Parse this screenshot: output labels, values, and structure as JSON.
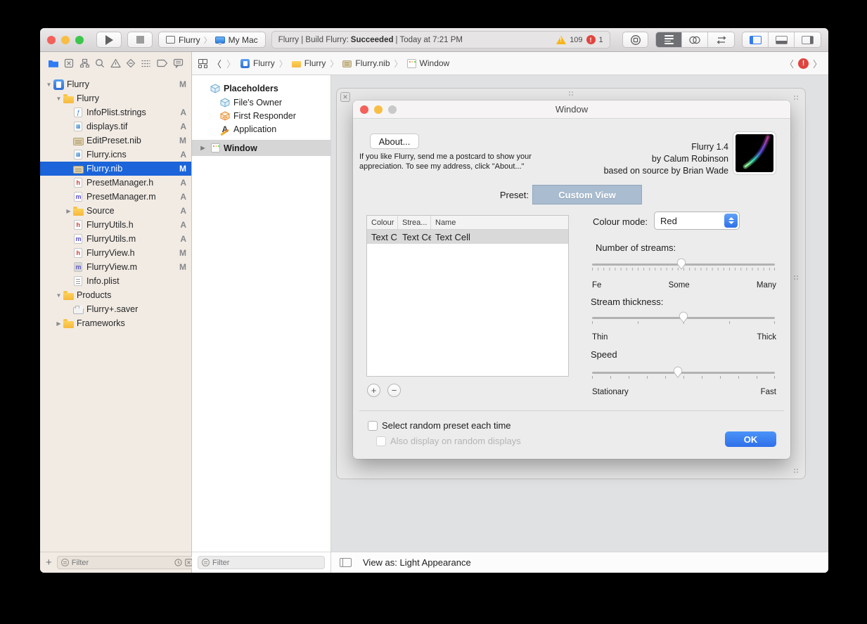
{
  "toolbar": {
    "scheme_project": "Flurry",
    "scheme_target": "My Mac",
    "activity_prefix": "Flurry | Build Flurry:",
    "activity_status": "Succeeded",
    "activity_suffix": "| Today at 7:21 PM",
    "warning_count": "109",
    "error_count": "1"
  },
  "navigator": {
    "filter_placeholder": "Filter",
    "files": [
      {
        "label": "Flurry",
        "icon": "project",
        "status": "M",
        "depth": 0,
        "disc": "open"
      },
      {
        "label": "Flurry",
        "icon": "folder",
        "status": "",
        "depth": 1,
        "disc": "open"
      },
      {
        "label": "InfoPlist.strings",
        "icon": "strings",
        "status": "A",
        "depth": 2
      },
      {
        "label": "displays.tif",
        "icon": "image",
        "status": "A",
        "depth": 2
      },
      {
        "label": "EditPreset.nib",
        "icon": "nib",
        "status": "M",
        "depth": 2
      },
      {
        "label": "Flurry.icns",
        "icon": "image",
        "status": "A",
        "depth": 2
      },
      {
        "label": "Flurry.nib",
        "icon": "nib",
        "status": "M",
        "depth": 2,
        "selected": true
      },
      {
        "label": "PresetManager.h",
        "icon": "h",
        "status": "A",
        "depth": 2
      },
      {
        "label": "PresetManager.m",
        "icon": "m",
        "status": "A",
        "depth": 2
      },
      {
        "label": "Source",
        "icon": "folder",
        "status": "A",
        "depth": 2,
        "disc": "closed"
      },
      {
        "label": "FlurryUtils.h",
        "icon": "h",
        "status": "A",
        "depth": 2
      },
      {
        "label": "FlurryUtils.m",
        "icon": "m",
        "status": "A",
        "depth": 2
      },
      {
        "label": "FlurryView.h",
        "icon": "h",
        "status": "M",
        "depth": 2
      },
      {
        "label": "FlurryView.m",
        "icon": "mgray",
        "status": "M",
        "depth": 2
      },
      {
        "label": "Info.plist",
        "icon": "plist",
        "status": "",
        "depth": 2
      },
      {
        "label": "Products",
        "icon": "folder",
        "status": "",
        "depth": 1,
        "disc": "open"
      },
      {
        "label": "Flurry+.saver",
        "icon": "saver",
        "status": "",
        "depth": 2
      },
      {
        "label": "Frameworks",
        "icon": "folder",
        "status": "",
        "depth": 1,
        "disc": "closed"
      }
    ]
  },
  "jumpbar": {
    "crumbs": [
      {
        "label": "Flurry"
      },
      {
        "label": "Flurry"
      },
      {
        "label": "Flurry.nib"
      },
      {
        "label": "Window"
      }
    ]
  },
  "dock": {
    "placeholders_header": "Placeholders",
    "items": [
      {
        "label": "File's Owner"
      },
      {
        "label": "First Responder"
      },
      {
        "label": "Application"
      }
    ],
    "window_label": "Window",
    "filter_placeholder": "Filter"
  },
  "design": {
    "window_title": "Window",
    "about_button": "About...",
    "blurb_line1": "If you like Flurry, send me a postcard to show your",
    "blurb_line2": "appreciation. To see my address, click \"About...\"",
    "credits": [
      "Flurry 1.4",
      "by Calum Robinson",
      "based on source by Brian Wade"
    ],
    "preset_label": "Preset:",
    "preset_value": "Custom View",
    "table": {
      "columns": [
        "Colour",
        "Strea...",
        "Name"
      ],
      "rows": [
        [
          "Text C",
          "Text Ce",
          "Text Cell"
        ]
      ]
    },
    "colour_mode_label": "Colour mode:",
    "colour_mode_value": "Red",
    "sliders": [
      {
        "label": "Number of streams:",
        "left": "Fe",
        "mid": "Some",
        "right": "Many",
        "value_pct": 49,
        "ticks": 33
      },
      {
        "label": "Stream thickness:",
        "left": "Thin",
        "right": "Thick",
        "value_pct": 50,
        "ticks": 5
      },
      {
        "label": "Speed",
        "left": "Stationary",
        "right": "Fast",
        "value_pct": 47,
        "ticks": 11
      }
    ],
    "checkbox_random_preset": "Select random preset each time",
    "checkbox_random_displays": "Also display on random displays",
    "ok_button": "OK",
    "colors": {
      "selection_blue": "#1b64d9",
      "ok_blue": "#3a80f2",
      "custom_view_fill": "#a9bcd0"
    }
  },
  "statusbar": {
    "view_as": "View as: Light Appearance"
  }
}
